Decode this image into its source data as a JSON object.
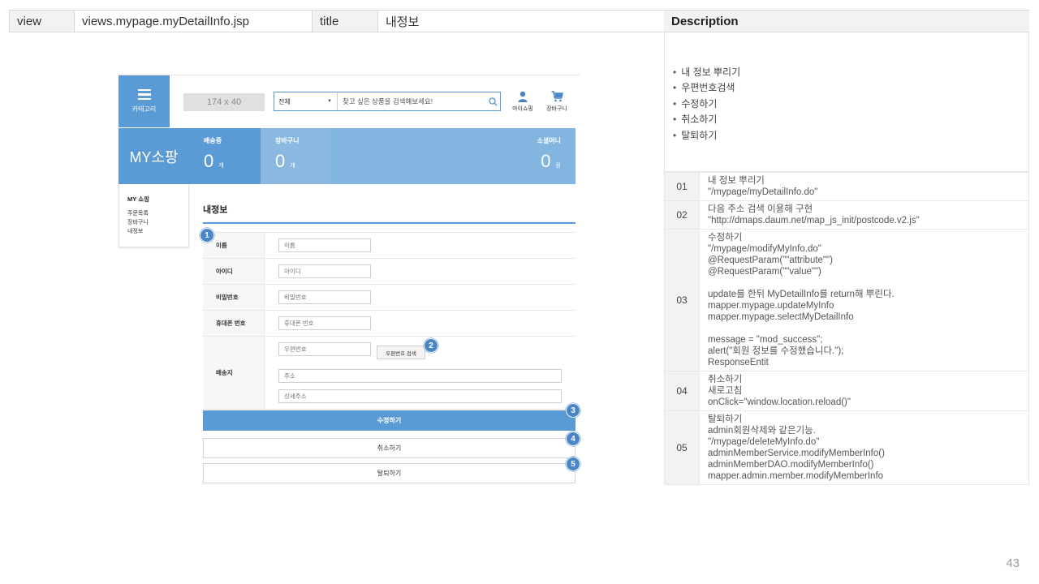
{
  "header": {
    "view_key": "view",
    "view_value": "views.mypage.myDetailInfo.jsp",
    "title_key": "title",
    "title_value": "내정보"
  },
  "description": {
    "title": "Description",
    "summary": [
      "내 정보 뿌리기",
      "우편번호검색",
      "수정하기",
      "취소하기",
      "탈퇴하기"
    ],
    "rows": [
      {
        "num": "01",
        "lines": [
          "내 정보 뿌리기",
          "\"/mypage/myDetailInfo.do\""
        ]
      },
      {
        "num": "02",
        "lines": [
          "다음 주소 검색 이용해 구현",
          "\"http://dmaps.daum.net/map_js_init/postcode.v2.js\""
        ]
      },
      {
        "num": "03",
        "lines": [
          "수정하기",
          "\"/mypage/modifyMyInfo.do\"",
          "@RequestParam(\"\"attribute\"\")",
          "@RequestParam(\"\"value\"\")",
          "",
          "update를 한뒤 MyDetailInfo를 return해 뿌린다.",
          "mapper.mypage.updateMyInfo",
          "mapper.mypage.selectMyDetailInfo",
          "",
          "message  = \"mod_success\";",
          "alert(\"회원 정보를 수정했습니다.\");",
          "ResponseEntit"
        ]
      },
      {
        "num": "04",
        "lines": [
          "취소하기",
          "새로고침",
          "onClick=\"window.location.reload()\""
        ]
      },
      {
        "num": "05",
        "lines": [
          "탈퇴하기",
          "admin회원삭제와 같은기능.",
          "\"/mypage/deleteMyInfo.do\"",
          "adminMemberService.modifyMemberInfo()",
          "adminMemberDAO.modifyMemberInfo()",
          "mapper.admin.member.modifyMemberInfo"
        ]
      }
    ]
  },
  "page_number": "43",
  "mock": {
    "category_label": "카테고리",
    "logo_placeholder": "174 x 40",
    "search": {
      "select": "전체",
      "placeholder": "찾고 싶은 상품을 검색해보세요!"
    },
    "icons": {
      "mypage": "마이쇼핑",
      "cart": "장바구니"
    },
    "stats": {
      "title": "MY소팡",
      "items": [
        {
          "label": "배송중",
          "value": "0",
          "unit": "개"
        },
        {
          "label": "장바구니",
          "value": "0",
          "unit": "개"
        },
        {
          "label": "소셜머니",
          "value": "0",
          "unit": "원"
        }
      ]
    },
    "sidebar": {
      "heading": "MY 쇼핑",
      "items": [
        "주문목록",
        "장바구니",
        "내정보"
      ]
    },
    "page_title": "내정보",
    "form": {
      "name": {
        "label": "이름",
        "placeholder": "이름"
      },
      "id": {
        "label": "아이디",
        "placeholder": "아이디"
      },
      "password": {
        "label": "비밀번호",
        "placeholder": "비밀번호"
      },
      "phone": {
        "label": "휴대폰 번호",
        "placeholder": "휴대폰 번호"
      },
      "delivery": {
        "label": "배송지",
        "zip_placeholder": "우편번호",
        "zip_button": "우편번호 검색",
        "addr_placeholder": "주소",
        "detail_placeholder": "상세주소"
      }
    },
    "buttons": {
      "modify": "수정하기",
      "cancel": "취소하기",
      "withdraw": "탈퇴하기"
    },
    "badges": [
      "1",
      "2",
      "3",
      "4",
      "5"
    ]
  },
  "colors": {
    "accent": "#5b9bd5",
    "accent_light": "#82b6e1",
    "badge": "#4a86c5"
  }
}
